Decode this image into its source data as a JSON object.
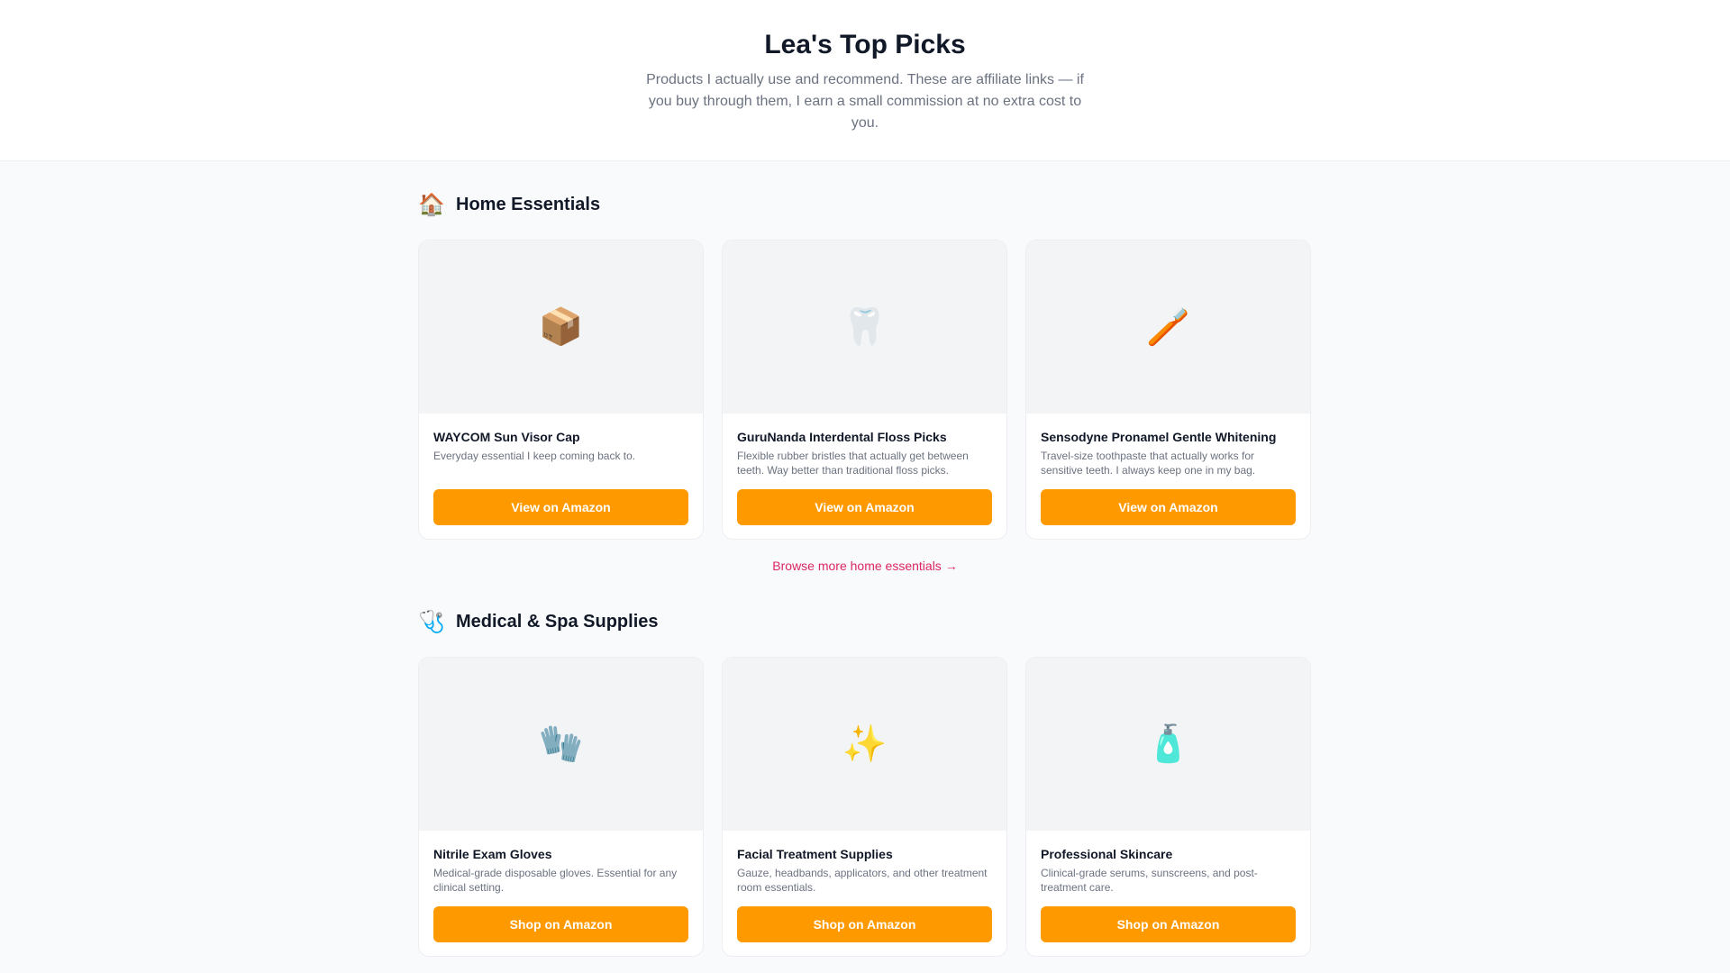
{
  "header": {
    "title": "Lea's Top Picks",
    "subtitle": "Products I actually use and recommend. These are affiliate links — if you buy through them, I earn a small commission at no extra cost to you."
  },
  "sections": [
    {
      "icon": "🏠",
      "icon_name": "house-icon",
      "title": "Home Essentials",
      "browse_link": "Browse more home essentials →",
      "products": [
        {
          "icon": "📦",
          "icon_name": "package-icon",
          "name": "WAYCOM Sun Visor Cap",
          "description": "Everyday essential I keep coming back to.",
          "button_label": "View on Amazon"
        },
        {
          "icon": "🦷",
          "icon_name": "tooth-icon",
          "name": "GuruNanda Interdental Floss Picks",
          "description": "Flexible rubber bristles that actually get between teeth. Way better than traditional floss picks.",
          "button_label": "View on Amazon"
        },
        {
          "icon": "🪥",
          "icon_name": "toothbrush-icon",
          "name": "Sensodyne Pronamel Gentle Whitening",
          "description": "Travel-size toothpaste that actually works for sensitive teeth. I always keep one in my bag.",
          "button_label": "View on Amazon"
        }
      ]
    },
    {
      "icon": "🩺",
      "icon_name": "stethoscope-icon",
      "title": "Medical & Spa Supplies",
      "products": [
        {
          "icon": "🧤",
          "icon_name": "gloves-icon",
          "name": "Nitrile Exam Gloves",
          "description": "Medical-grade disposable gloves. Essential for any clinical setting.",
          "button_label": "Shop on Amazon"
        },
        {
          "icon": "✨",
          "icon_name": "sparkles-icon",
          "name": "Facial Treatment Supplies",
          "description": "Gauze, headbands, applicators, and other treatment room essentials.",
          "button_label": "Shop on Amazon"
        },
        {
          "icon": "🧴",
          "icon_name": "lotion-bottle-icon",
          "name": "Professional Skincare",
          "description": "Clinical-grade serums, sunscreens, and post-treatment care.",
          "button_label": "Shop on Amazon"
        }
      ]
    }
  ],
  "colors": {
    "button": "#ff9900",
    "link": "#db2763",
    "page_background": "#f9fafb",
    "image_background": "#f3f4f6"
  }
}
